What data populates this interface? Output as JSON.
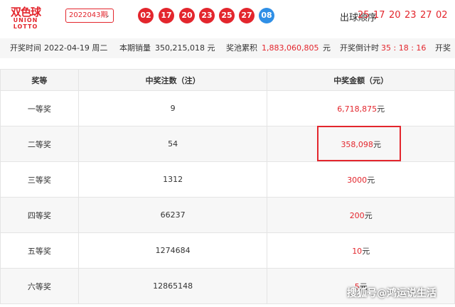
{
  "logo": {
    "cn": "双色球",
    "en_line1": "UNION",
    "en_line2": "LOTTO"
  },
  "period": {
    "value": "2022043期",
    "chevron": "chevron-down-icon"
  },
  "balls": {
    "red": [
      "02",
      "17",
      "20",
      "23",
      "25",
      "27"
    ],
    "blue": "08"
  },
  "order": {
    "label": "出球顺序",
    "numbers": [
      "25",
      "17",
      "20",
      "23",
      "27",
      "02"
    ]
  },
  "info": {
    "draw_time_label": "开奖时间",
    "draw_time_value": "2022-04-19 周二",
    "sales_label": "本期销量",
    "sales_value": "350,215,018 元",
    "pool_label": "奖池累积",
    "pool_value": "1,883,060,805",
    "pool_unit": "元",
    "countdown_label": "开奖倒计时",
    "countdown_value": "35 : 18 : 16",
    "trailing_label": "开奖"
  },
  "table": {
    "headers": [
      "奖等",
      "中奖注数（注）",
      "中奖金额（元）"
    ],
    "rows": [
      {
        "level": "一等奖",
        "count": "9",
        "amount": "6,718,875",
        "unit": "元"
      },
      {
        "level": "二等奖",
        "count": "54",
        "amount": "358,098",
        "unit": "元"
      },
      {
        "level": "三等奖",
        "count": "1312",
        "amount": "3000",
        "unit": "元"
      },
      {
        "level": "四等奖",
        "count": "66237",
        "amount": "200",
        "unit": "元"
      },
      {
        "level": "五等奖",
        "count": "1274684",
        "amount": "10",
        "unit": "元"
      },
      {
        "level": "六等奖",
        "count": "12865148",
        "amount": "5",
        "unit": "元"
      }
    ]
  },
  "watermark": "搜狐号@鸿运说生活",
  "colors": {
    "accent": "#e3262d",
    "blue_ball": "#2f8fe6"
  }
}
